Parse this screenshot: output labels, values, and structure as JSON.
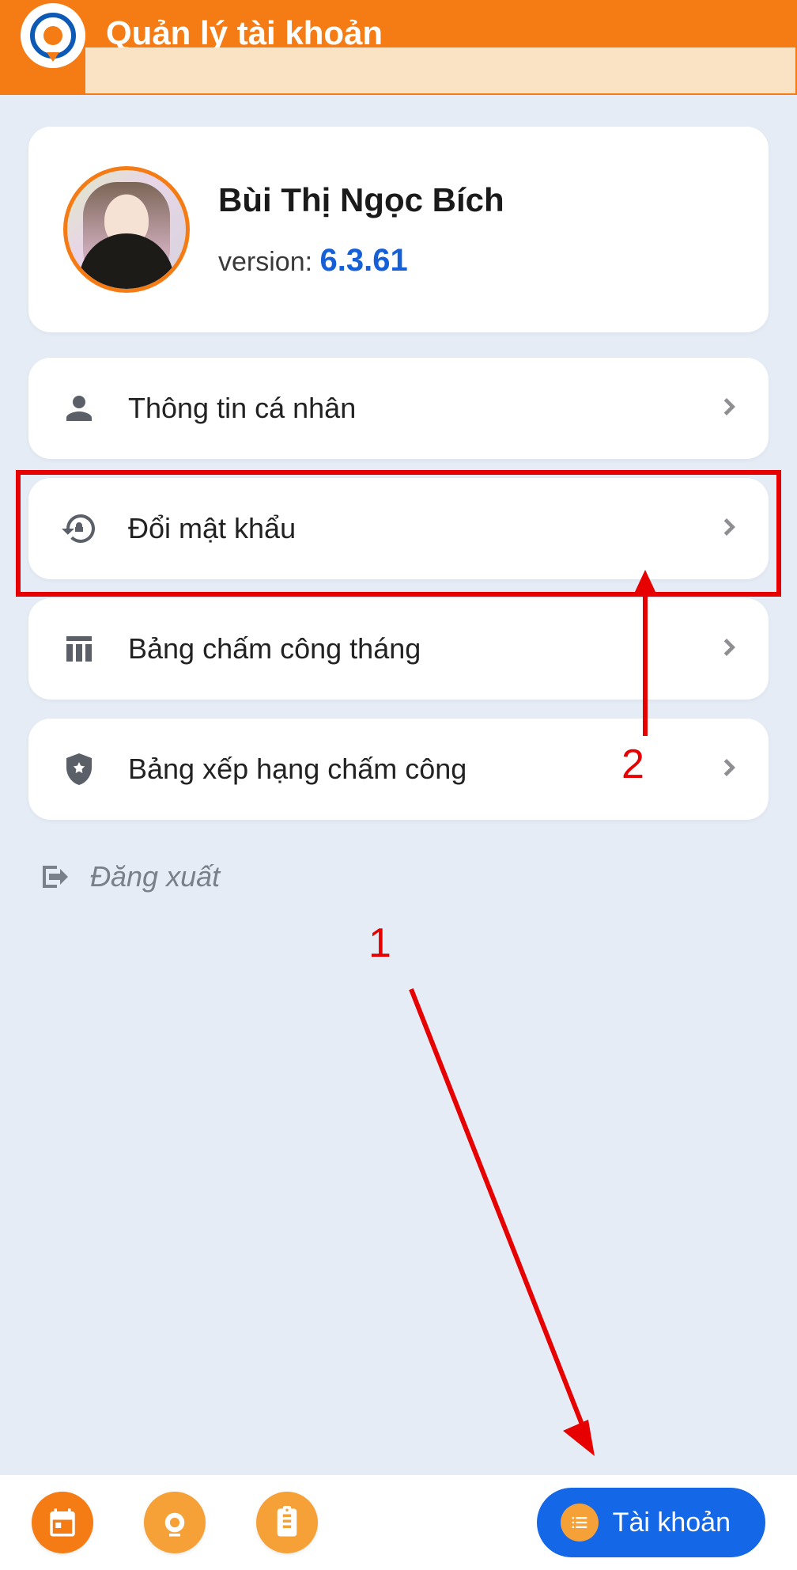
{
  "header": {
    "title": "Quản lý tài khoản"
  },
  "profile": {
    "name": "Bùi Thị Ngọc Bích",
    "version_label": "version: ",
    "version_number": "6.3.61"
  },
  "menu": {
    "personal_info": "Thông tin cá nhân",
    "change_password": "Đổi mật khẩu",
    "monthly_timesheet": "Bảng chấm công tháng",
    "timesheet_ranking": "Bảng xếp hạng chấm công"
  },
  "logout_label": "Đăng xuất",
  "annotations": {
    "step1": "1",
    "step2": "2"
  },
  "nav": {
    "account_label": "Tài khoản"
  }
}
